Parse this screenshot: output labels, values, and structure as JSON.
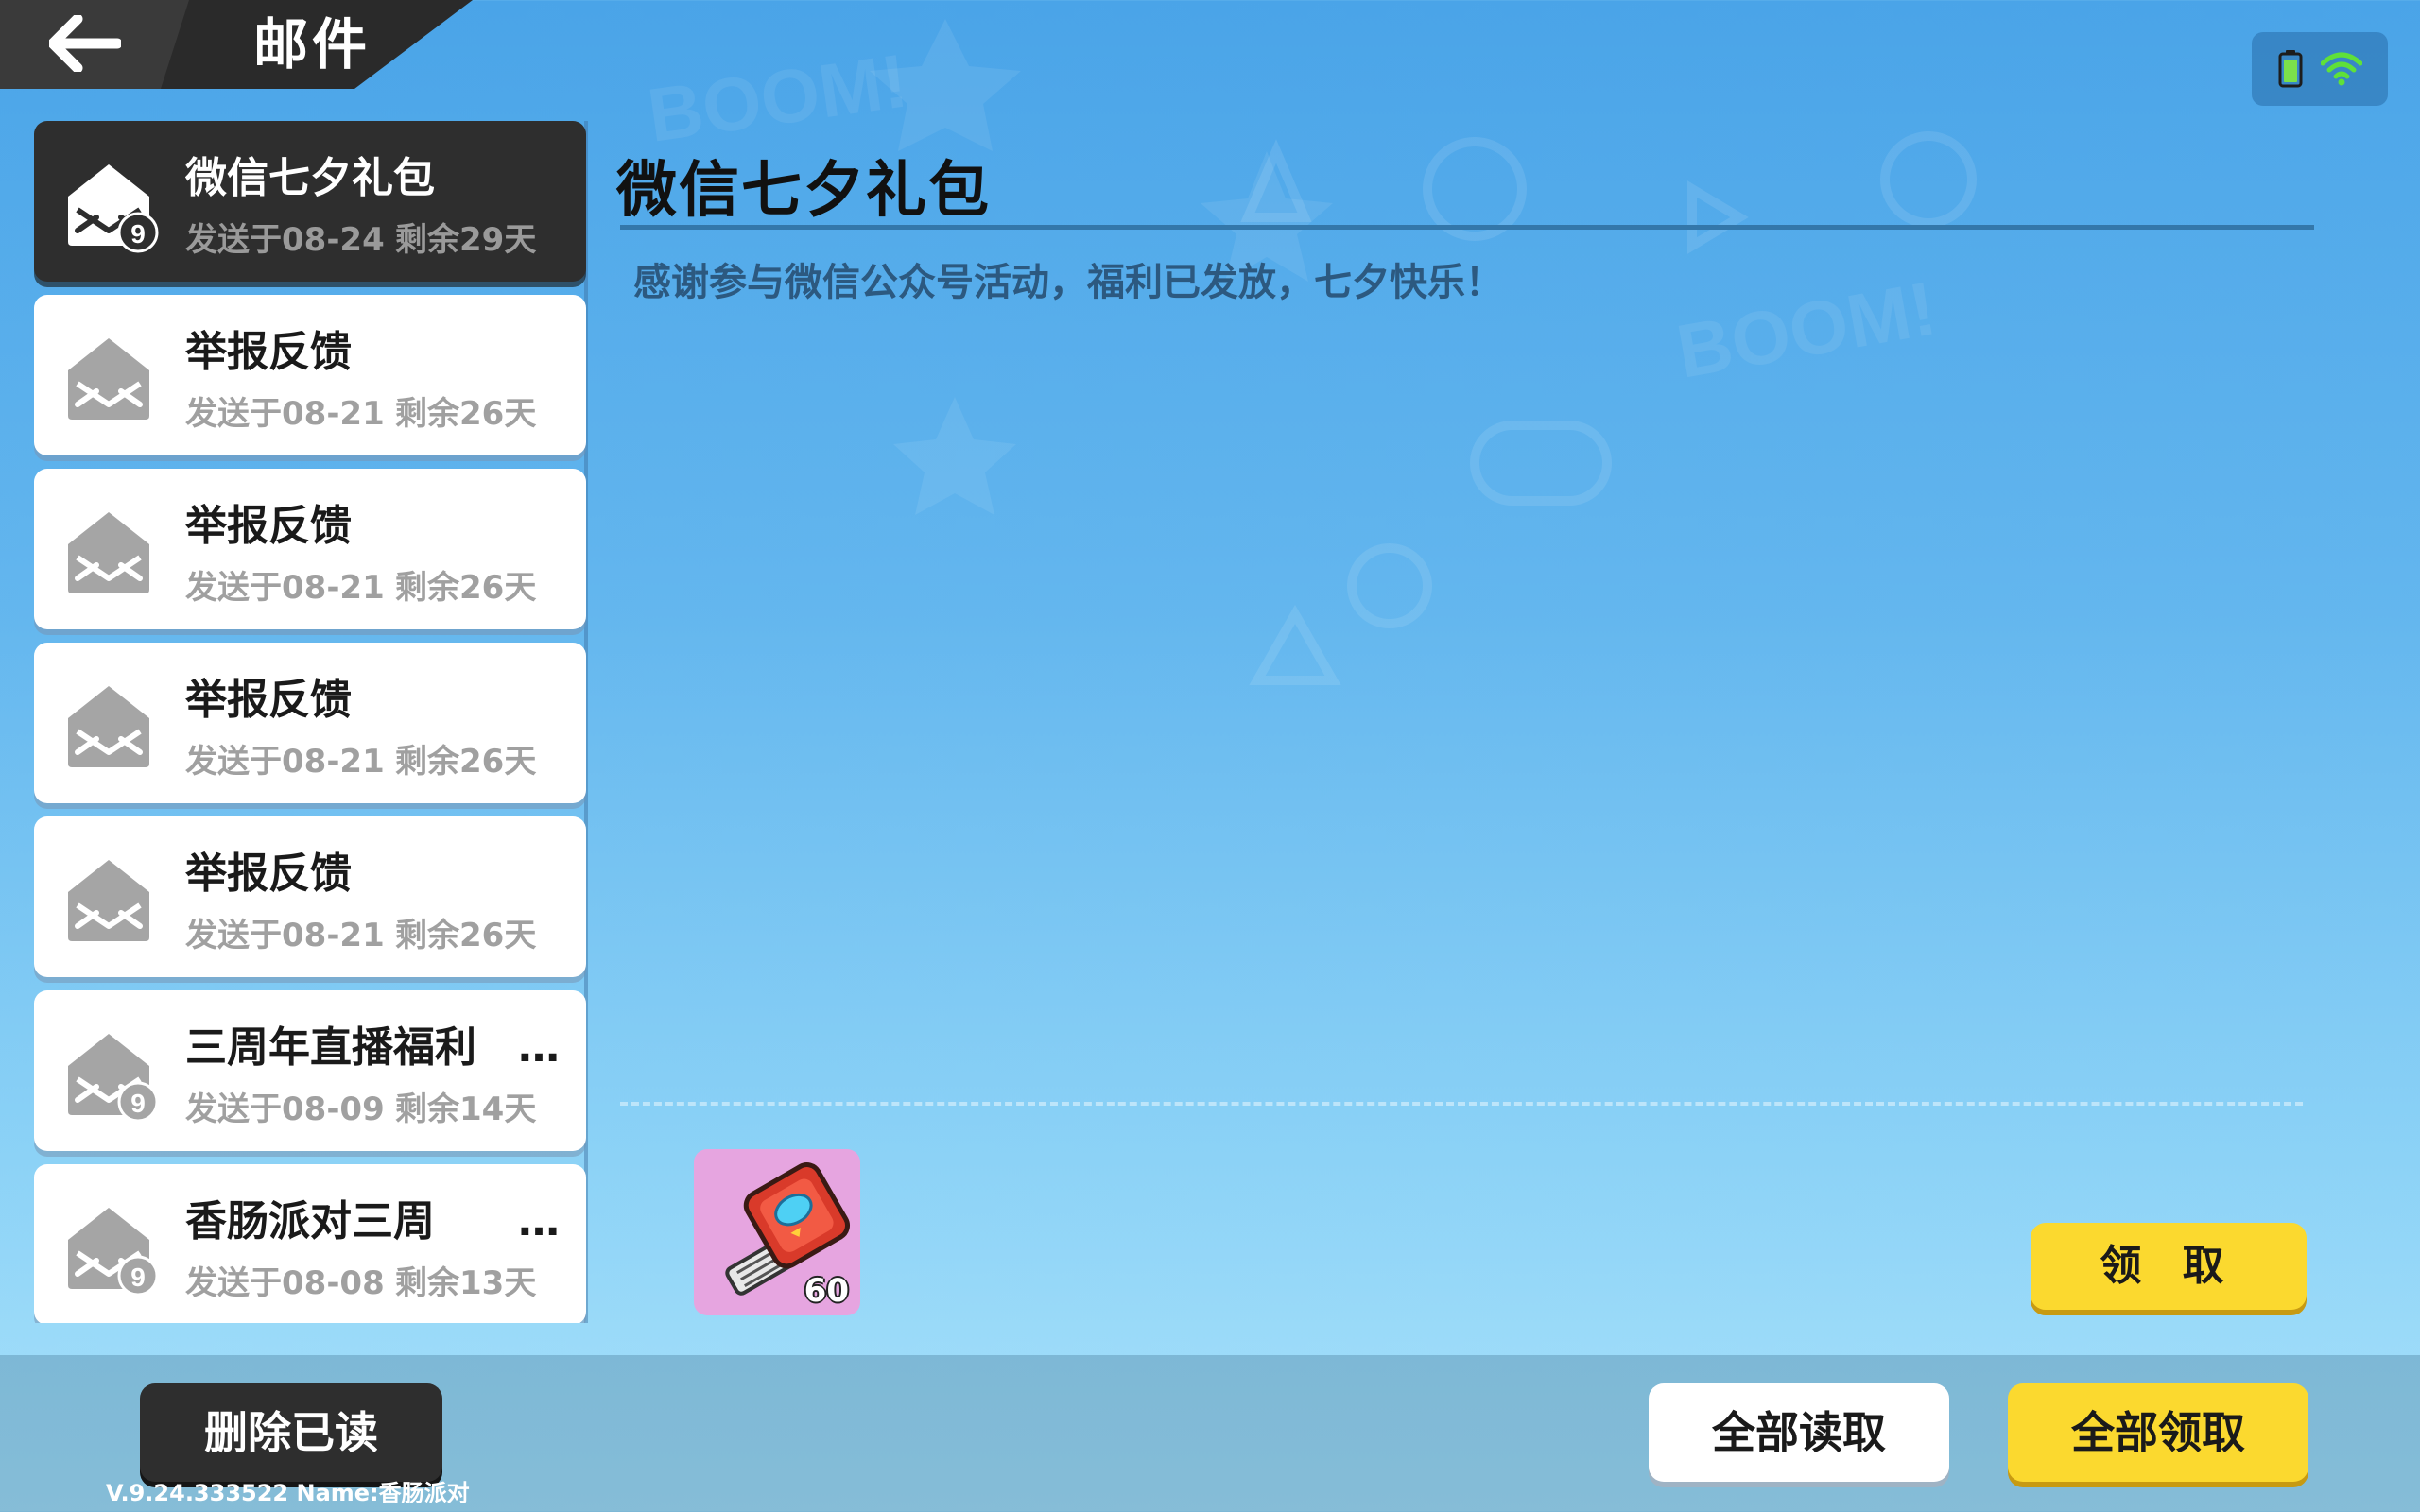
{
  "header": {
    "title": "邮件",
    "back_icon": "back-arrow-icon"
  },
  "status": {
    "battery_icon": "battery-icon",
    "wifi_icon": "wifi-icon",
    "battery_color": "#7be04a",
    "wifi_color": "#5fe03a"
  },
  "mails": [
    {
      "title": "微信七夕礼包",
      "sent": "发送于08-24",
      "remain": "剩余29天",
      "attachment_badge": true,
      "selected": true
    },
    {
      "title": "举报反馈",
      "sent": "发送于08-21",
      "remain": "剩余26天",
      "attachment_badge": false,
      "selected": false
    },
    {
      "title": "举报反馈",
      "sent": "发送于08-21",
      "remain": "剩余26天",
      "attachment_badge": false,
      "selected": false
    },
    {
      "title": "举报反馈",
      "sent": "发送于08-21",
      "remain": "剩余26天",
      "attachment_badge": false,
      "selected": false
    },
    {
      "title": "举报反馈",
      "sent": "发送于08-21",
      "remain": "剩余26天",
      "attachment_badge": false,
      "selected": false
    },
    {
      "title": "三周年直播福利　…",
      "sent": "发送于08-09",
      "remain": "剩余14天",
      "attachment_badge": true,
      "selected": false
    },
    {
      "title": "香肠派对三周　　…",
      "sent": "发送于08-08",
      "remain": "剩余13天",
      "attachment_badge": true,
      "selected": false
    }
  ],
  "detail": {
    "title": "微信七夕礼包",
    "body": "感谢参与微信公众号活动，福利已发放，七夕快乐！",
    "reward": {
      "icon": "key-card-icon",
      "count": "60"
    },
    "claim_label": "领 取"
  },
  "footer": {
    "delete_read_label": "删除已读",
    "read_all_label": "全部读取",
    "claim_all_label": "全部领取",
    "version": "V.9.24.333522 Name:香肠派对"
  },
  "colors": {
    "accent_yellow": "#fbd92f",
    "dark_panel": "#2e2e2e",
    "background_blue": "#63b6ee"
  }
}
